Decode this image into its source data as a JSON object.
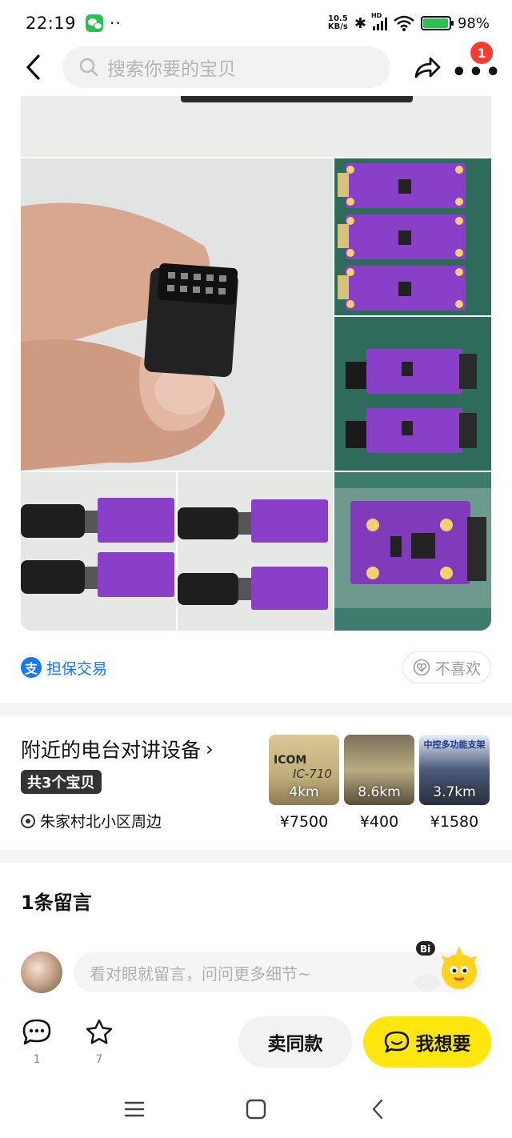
{
  "status_bar": {
    "time": "22:19",
    "dots": "··",
    "net_speed_value": "10.5",
    "net_speed_unit": "KB/s",
    "hd_label": "HD",
    "battery_percent": "98%",
    "battery_level": 0.98
  },
  "topnav": {
    "search_placeholder": "搜索你要的宝贝",
    "notification_count": "1"
  },
  "gallery": {
    "image_count": 8
  },
  "guarantee": {
    "label": "担保交易",
    "dislike_label": "不喜欢"
  },
  "nearby": {
    "title_prefix": "附近的",
    "title_highlight": "电台对讲设备",
    "count_label": "共3个宝贝",
    "location": "朱家村北小区周边",
    "items": [
      {
        "distance": "4km",
        "price": "¥7500",
        "image_text_1": "ICOM",
        "image_text_2": "IC-710"
      },
      {
        "distance": "8.6km",
        "price": "¥400"
      },
      {
        "distance": "3.7km",
        "price": "¥1580",
        "image_text_1": "中控多功能支架"
      }
    ]
  },
  "comments": {
    "title": "1条留言",
    "input_placeholder": "看对眼就留言，问问更多细节~"
  },
  "action_bar": {
    "comment_count": "1",
    "favorite_count": "7",
    "same_item_label": "卖同款",
    "want_label": "我想要"
  },
  "colors": {
    "brand_yellow": "#ffe60f",
    "alipay_blue": "#1677ff",
    "badge_red": "#ff3b30",
    "pcb_purple": "#8a3fc9"
  }
}
